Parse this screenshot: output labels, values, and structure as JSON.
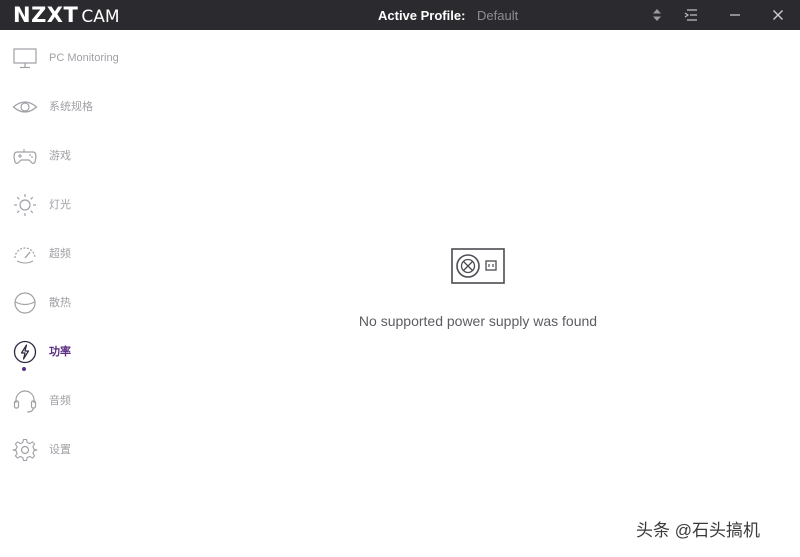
{
  "app": {
    "logo_main": "NZXT",
    "logo_sub": "CAM"
  },
  "titlebar": {
    "profile_label": "Active Profile:",
    "profile_value": "Default",
    "buttons": [
      "sort-icon",
      "menu-icon",
      "minimize-icon",
      "close-icon"
    ]
  },
  "sidebar": {
    "items": [
      {
        "label": "PC Monitoring",
        "icon": "monitor-icon"
      },
      {
        "label": "系统规格",
        "icon": "eye-icon"
      },
      {
        "label": "游戏",
        "icon": "gamepad-icon"
      },
      {
        "label": "灯光",
        "icon": "sun-icon"
      },
      {
        "label": "超频",
        "icon": "speedometer-icon"
      },
      {
        "label": "散热",
        "icon": "fan-icon"
      },
      {
        "label": "功率",
        "icon": "lightning-icon",
        "active": true
      },
      {
        "label": "音频",
        "icon": "headset-icon"
      },
      {
        "label": "设置",
        "icon": "gear-icon"
      }
    ]
  },
  "main": {
    "empty_icon": "power-supply-icon",
    "empty_message": "No supported power supply was found"
  },
  "watermark": "头条 @石头搞机",
  "colors": {
    "titlebar_bg": "#2b2b2f",
    "accent": "#5a2d82",
    "icon_gray": "#a0a0a6",
    "text_gray": "#5c5c63"
  }
}
